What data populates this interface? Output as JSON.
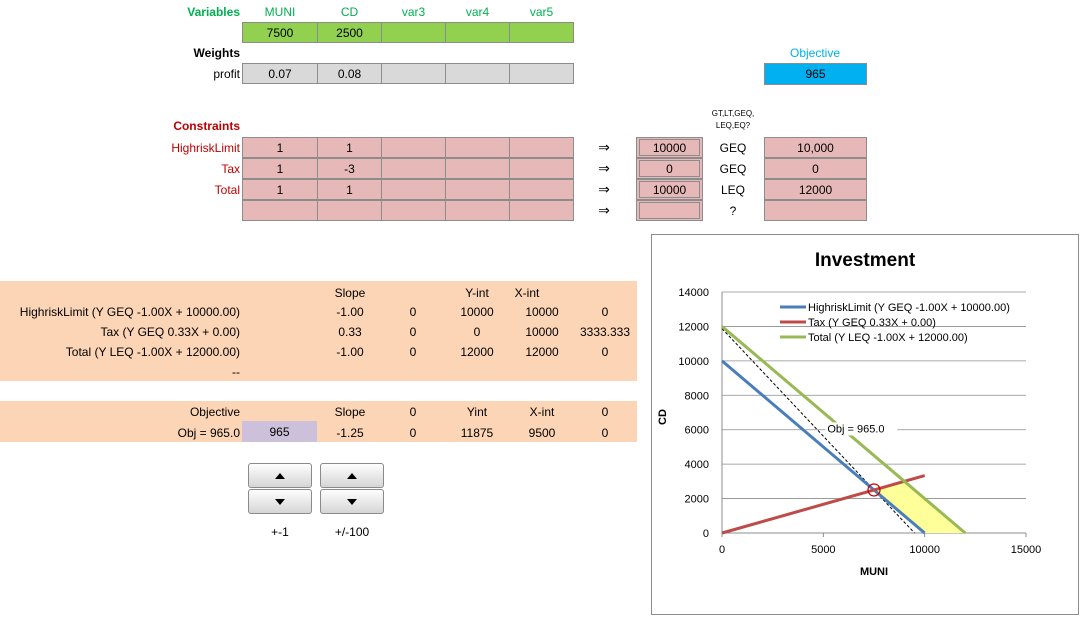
{
  "variables": {
    "label": "Variables",
    "headers": [
      "MUNI",
      "CD",
      "var3",
      "var4",
      "var5"
    ],
    "values": [
      "7500",
      "2500",
      "",
      "",
      ""
    ]
  },
  "weights": {
    "label": "Weights",
    "row_label": "profit",
    "values": [
      "0.07",
      "0.08",
      "",
      "",
      ""
    ]
  },
  "objective": {
    "label": "Objective",
    "value": "965"
  },
  "constraints": {
    "label": "Constraints",
    "type_header": "GT,LT,GEQ,\nLEQ,EQ?",
    "rows": [
      {
        "name": "HighriskLimit",
        "coef": [
          "1",
          "1",
          "",
          "",
          ""
        ],
        "arrow": "⇒",
        "lhs": "10000",
        "type": "GEQ",
        "rhs": "10,000"
      },
      {
        "name": "Tax",
        "coef": [
          "1",
          "-3",
          "",
          "",
          ""
        ],
        "arrow": "⇒",
        "lhs": "0",
        "type": "GEQ",
        "rhs": "0"
      },
      {
        "name": "Total",
        "coef": [
          "1",
          "1",
          "",
          "",
          ""
        ],
        "arrow": "⇒",
        "lhs": "10000",
        "type": "LEQ",
        "rhs": "12000"
      },
      {
        "name": "",
        "coef": [
          "",
          "",
          "",
          "",
          ""
        ],
        "arrow": "⇒",
        "lhs": "",
        "type": "?",
        "rhs": ""
      }
    ]
  },
  "lines_table": {
    "headers": {
      "slope": "Slope",
      "yint": "Y-int",
      "xint": "X-int"
    },
    "rows": [
      {
        "label": "HighriskLimit (Y GEQ -1.00X + 10000.00)",
        "slope": "-1.00",
        "z": "0",
        "yint": "10000",
        "xint": "10000",
        "extra": "0"
      },
      {
        "label": "Tax (Y GEQ 0.33X + 0.00)",
        "slope": "0.33",
        "z": "0",
        "yint": "0",
        "xint": "10000",
        "extra": "3333.333"
      },
      {
        "label": "Total (Y LEQ -1.00X + 12000.00)",
        "slope": "-1.00",
        "z": "0",
        "yint": "12000",
        "xint": "12000",
        "extra": "0"
      },
      {
        "label": "--",
        "slope": "",
        "z": "",
        "yint": "",
        "xint": "",
        "extra": ""
      }
    ]
  },
  "objective_table": {
    "label": "Objective",
    "headers": {
      "slope": "Slope",
      "z": "0",
      "yint": "Yint",
      "xint": "X-int",
      "extra": "0"
    },
    "row": {
      "label": "Obj = 965.0",
      "value": "965",
      "slope": "-1.25",
      "z": "0",
      "yint": "11875",
      "xint": "9500",
      "extra": "0"
    }
  },
  "spinners": {
    "label1": "+-1",
    "label2": "+/-100"
  },
  "colors": {
    "green": "#92d050",
    "pink": "#e6b9b8",
    "gray": "#d9d9d9",
    "blue": "#00b0f0",
    "band": "#fbd5b5",
    "label_green": "#00b050",
    "label_red": "#c00000",
    "series_blue": "#4a7ebb",
    "series_red": "#be4b48",
    "series_green": "#98b954",
    "feasible": "#ffff99"
  },
  "chart_data": {
    "type": "line",
    "title": "Investment",
    "xlabel": "MUNI",
    "ylabel": "CD",
    "xlim": [
      0,
      15000
    ],
    "ylim": [
      0,
      14000
    ],
    "xticks": [
      0,
      5000,
      10000,
      15000
    ],
    "yticks": [
      0,
      2000,
      4000,
      6000,
      8000,
      10000,
      12000,
      14000
    ],
    "grid": "horizontal",
    "legend": "top-right",
    "series": [
      {
        "name": "HighriskLimit (Y GEQ -1.00X + 10000.00)",
        "color": "#4a7ebb",
        "points": [
          [
            0,
            10000
          ],
          [
            10000,
            0
          ]
        ]
      },
      {
        "name": "Tax (Y GEQ 0.33X + 0.00)",
        "color": "#be4b48",
        "points": [
          [
            0,
            0
          ],
          [
            10000,
            3333.333
          ]
        ]
      },
      {
        "name": "Total (Y LEQ -1.00X + 12000.00)",
        "color": "#98b954",
        "points": [
          [
            0,
            12000
          ],
          [
            12000,
            0
          ]
        ]
      }
    ],
    "objective_line": {
      "label": "Obj = 965.0",
      "points": [
        [
          0,
          11875
        ],
        [
          9500,
          0
        ]
      ]
    },
    "feasible_region": [
      [
        7500,
        2500
      ],
      [
        9000,
        3000
      ],
      [
        12000,
        0
      ],
      [
        10000,
        0
      ]
    ],
    "optimum": [
      7500,
      2500
    ]
  }
}
